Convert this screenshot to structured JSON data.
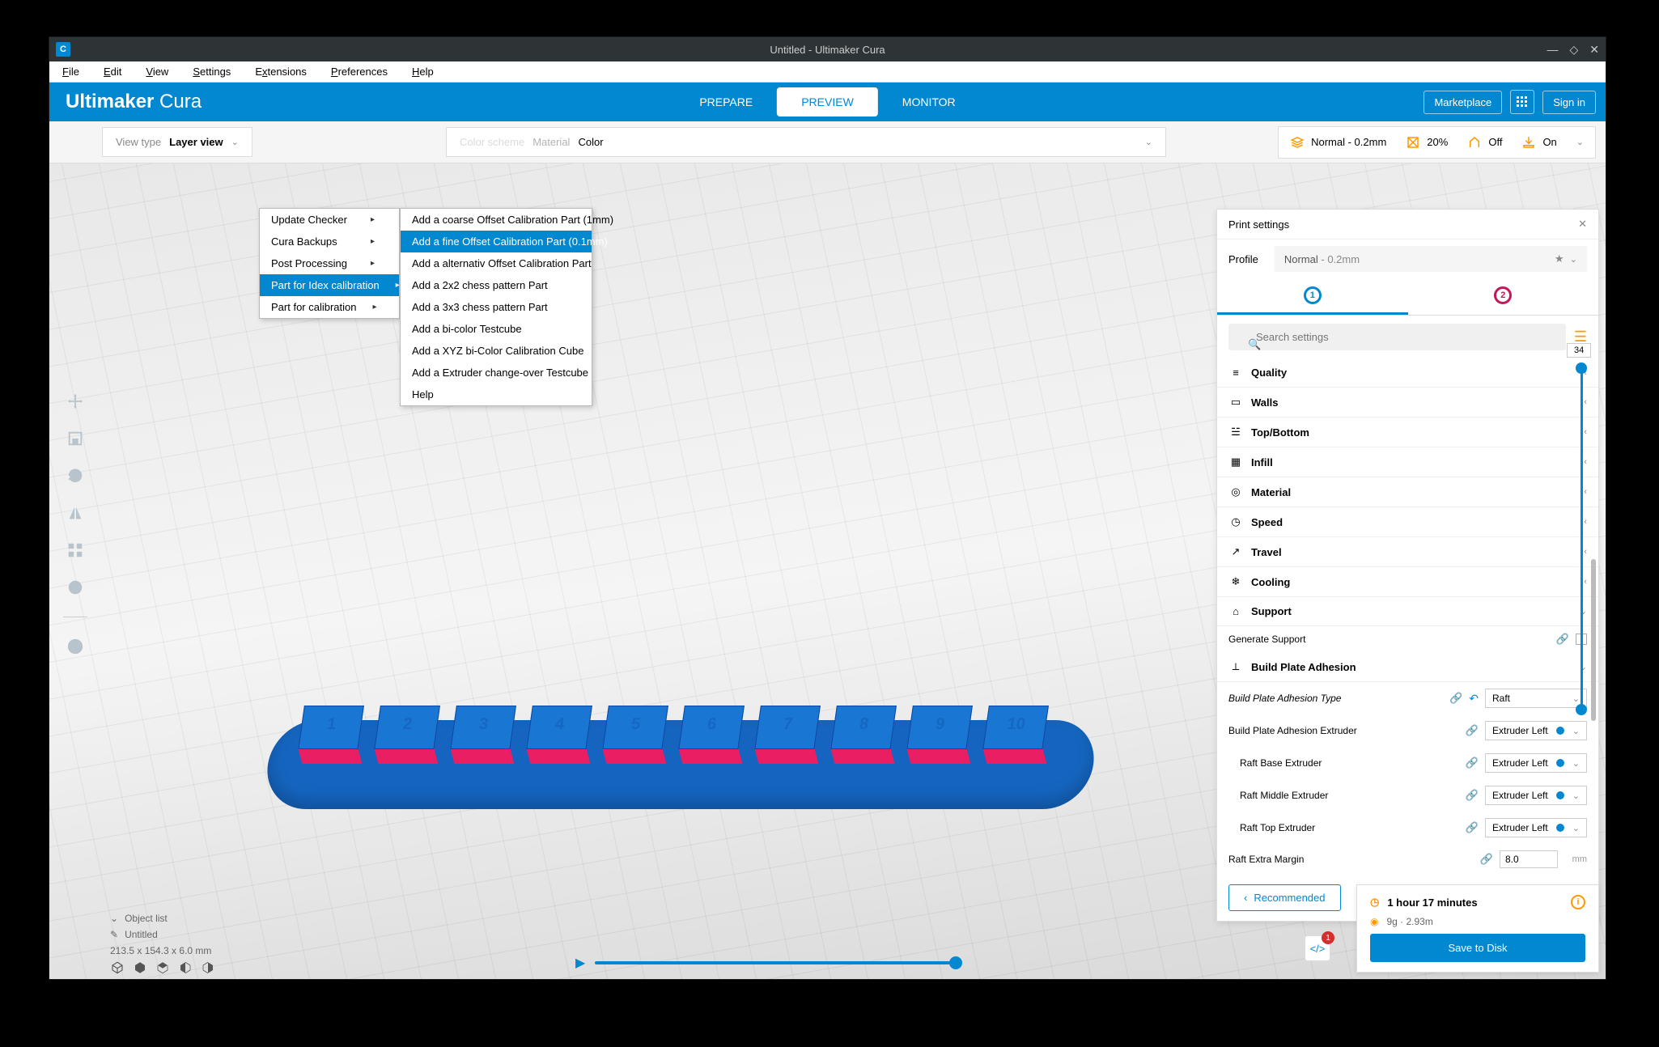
{
  "window": {
    "title": "Untitled - Ultimaker Cura"
  },
  "menubar": [
    "File",
    "Edit",
    "View",
    "Settings",
    "Extensions",
    "Preferences",
    "Help"
  ],
  "menubar_underline": [
    "F",
    "E",
    "V",
    "S",
    "x",
    "P",
    "H"
  ],
  "logo": {
    "bold": "Ultimaker",
    "rest": " Cura"
  },
  "stages": {
    "prepare": "PREPARE",
    "preview": "PREVIEW",
    "monitor": "MONITOR"
  },
  "topright": {
    "marketplace": "Marketplace",
    "signin": "Sign in"
  },
  "cfg": {
    "viewtype_label": "View type",
    "viewtype_value": "Layer view",
    "colorscheme_label": "Color scheme",
    "colorscheme_value": "Material Color",
    "profile": "Normal - 0.2mm",
    "infill": "20%",
    "support": "Off",
    "adhesion": "On"
  },
  "ext_menu": {
    "items": [
      "Update Checker",
      "Cura Backups",
      "Post Processing",
      "Part for Idex calibration",
      "Part for calibration"
    ],
    "submenu": [
      "Add a coarse Offset Calibration Part (1mm)",
      "Add a fine Offset Calibration Part (0.1mm)",
      "Add a alternativ Offset Calibration Part",
      "Add a 2x2 chess pattern Part",
      "Add a 3x3 chess pattern Part",
      "Add a bi-color Testcube",
      "Add a XYZ bi-Color Calibration Cube",
      "Add a Extruder change-over Testcube",
      "Help"
    ]
  },
  "panel": {
    "title": "Print settings",
    "profile_label": "Profile",
    "profile_value_a": "Normal",
    "profile_value_b": " - 0.2mm",
    "search_placeholder": "Search settings",
    "categories": [
      "Quality",
      "Walls",
      "Top/Bottom",
      "Infill",
      "Material",
      "Speed",
      "Travel",
      "Cooling",
      "Support",
      "Build Plate Adhesion"
    ],
    "gen_support": "Generate Support",
    "adh_type_lbl": "Build Plate Adhesion Type",
    "adh_type_val": "Raft",
    "adh_ext_lbl": "Build Plate Adhesion Extruder",
    "ext_val": "Extruder Left",
    "raft_base": "Raft Base Extruder",
    "raft_mid": "Raft Middle Extruder",
    "raft_top": "Raft Top Extruder",
    "raft_margin_lbl": "Raft Extra Margin",
    "raft_margin_val": "8.0",
    "raft_margin_unit": "mm",
    "recommended": "Recommended"
  },
  "slider_top_label": "34",
  "object": {
    "list_label": "Object list",
    "name": "Untitled",
    "dims": "213.5 x 154.3 x 6.0 mm"
  },
  "info": {
    "time": "1 hour 17 minutes",
    "mat": "9g · 2.93m",
    "save": "Save to Disk"
  },
  "code_badge": "1",
  "pieces": [
    1,
    2,
    3,
    4,
    5,
    6,
    7,
    8,
    9,
    10
  ]
}
